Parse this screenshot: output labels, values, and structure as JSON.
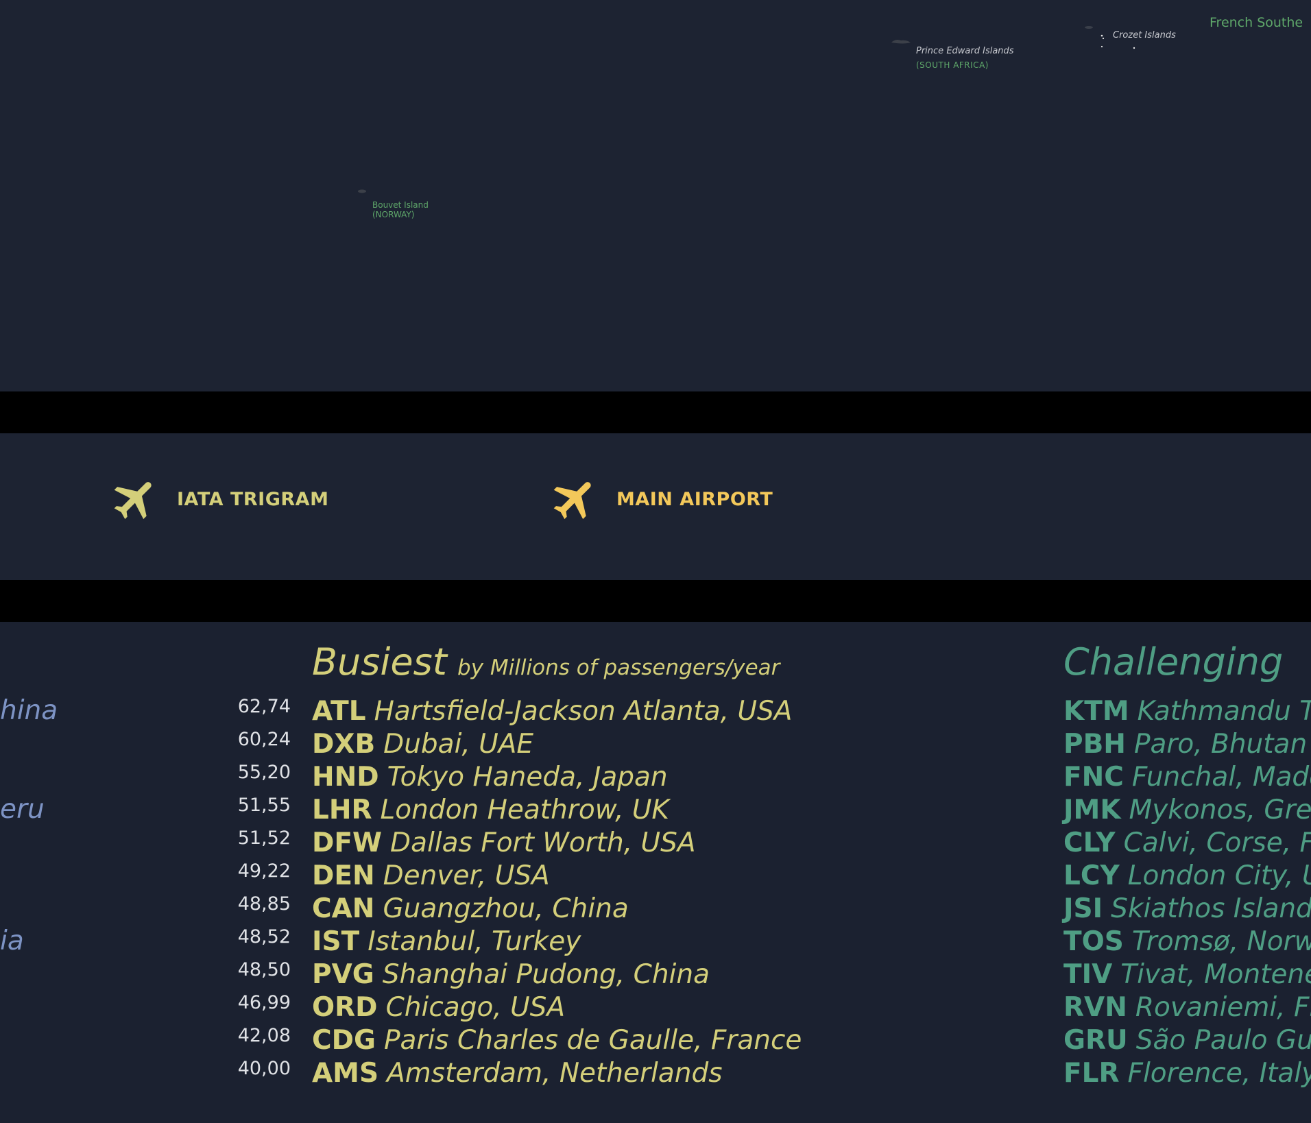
{
  "map": {
    "labels": {
      "french_southern": "French Southe",
      "crozet": "Crozet Islands",
      "prince_edward": "Prince Edward Islands",
      "prince_edward_country": "(SOUTH AFRICA)",
      "bouvet": "Bouvet Island",
      "bouvet_country": "(NORWAY)"
    },
    "colors": {
      "land_label": "#5fa86a",
      "island_label": "#c7c9cf",
      "background": "#1d2332"
    }
  },
  "legend": {
    "items": [
      {
        "label": "IATA TRIGRAM",
        "icon": "airplane-icon",
        "color": "#d4cf7a"
      },
      {
        "label": "MAIN AIRPORT",
        "icon": "airplane-icon",
        "color": "#f3c85a"
      }
    ]
  },
  "left_fragments": [
    "hina",
    "eru",
    "ia"
  ],
  "busiest": {
    "title": "Busiest",
    "subtitle": "by Millions of passengers/year",
    "rows": [
      {
        "value": "62,74",
        "code": "ATL",
        "name": "Hartsfield-Jackson Atlanta, USA"
      },
      {
        "value": "60,24",
        "code": "DXB",
        "name": "Dubai, UAE"
      },
      {
        "value": "55,20",
        "code": "HND",
        "name": "Tokyo Haneda, Japan"
      },
      {
        "value": "51,55",
        "code": "LHR",
        "name": "London Heathrow, UK"
      },
      {
        "value": "51,52",
        "code": "DFW",
        "name": "Dallas Fort Worth, USA"
      },
      {
        "value": "49,22",
        "code": "DEN",
        "name": "Denver, USA"
      },
      {
        "value": "48,85",
        "code": "CAN",
        "name": "Guangzhou, China"
      },
      {
        "value": "48,52",
        "code": "IST",
        "name": "Istanbul, Turkey"
      },
      {
        "value": "48,50",
        "code": "PVG",
        "name": "Shanghai Pudong, China"
      },
      {
        "value": "46,99",
        "code": "ORD",
        "name": "Chicago, USA"
      },
      {
        "value": "42,08",
        "code": "CDG",
        "name": "Paris Charles de Gaulle, France"
      },
      {
        "value": "40,00",
        "code": "AMS",
        "name": "Amsterdam, Netherlands"
      }
    ],
    "color": "#d4cf7a"
  },
  "challenging": {
    "title": "Challenging",
    "rows": [
      {
        "code": "KTM",
        "name": "Kathmandu T"
      },
      {
        "code": "PBH",
        "name": "Paro, Bhutan"
      },
      {
        "code": "FNC",
        "name": "Funchal, Made"
      },
      {
        "code": "JMK",
        "name": "Mykonos, Gre"
      },
      {
        "code": "CLY",
        "name": "Calvi, Corse, F"
      },
      {
        "code": "LCY",
        "name": "London City, U"
      },
      {
        "code": "JSI",
        "name": "Skiathos Island"
      },
      {
        "code": "TOS",
        "name": "Tromsø, Norw"
      },
      {
        "code": "TIV",
        "name": "Tivat, Montene"
      },
      {
        "code": "RVN",
        "name": "Rovaniemi, Fin"
      },
      {
        "code": "GRU",
        "name": "São Paulo Gu"
      },
      {
        "code": "FLR",
        "name": "Florence, Italy"
      }
    ],
    "color": "#4f9e84"
  }
}
